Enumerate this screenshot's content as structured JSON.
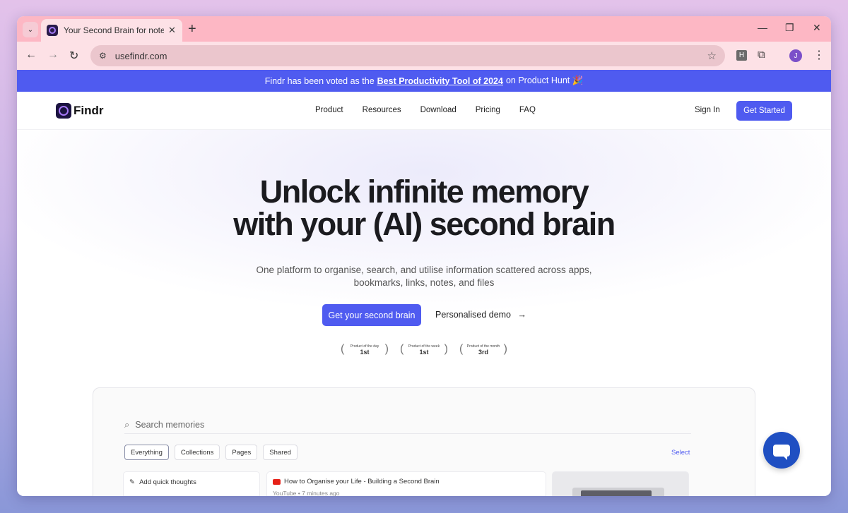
{
  "browser": {
    "tab_title": "Your Second Brain for notes, ap",
    "url": "usefindr.com",
    "avatar_initial": "J",
    "ext_label": "H"
  },
  "banner": {
    "prefix": "Findr has been voted as the",
    "link": "Best Productivity Tool of 2024",
    "suffix": "on Product Hunt 🎉"
  },
  "nav": {
    "brand": "Findr",
    "links": [
      "Product",
      "Resources",
      "Download",
      "Pricing",
      "FAQ"
    ],
    "sign_in": "Sign In",
    "get_started": "Get Started"
  },
  "hero": {
    "headline_1": "Unlock infinite memory",
    "headline_2": "with your (AI) second brain",
    "sub_1": "One platform to organise, search, and utilise information scattered across apps,",
    "sub_2": "bookmarks, links, notes, and files",
    "cta": "Get your second brain",
    "demo": "Personalised demo",
    "badges": [
      {
        "label": "Product of the day",
        "rank": "1st"
      },
      {
        "label": "Product of the week",
        "rank": "1st"
      },
      {
        "label": "Product of the month",
        "rank": "3rd"
      }
    ]
  },
  "app": {
    "search_placeholder": "Search memories",
    "filters": [
      "Everything",
      "Collections",
      "Pages",
      "Shared"
    ],
    "select": "Select",
    "quick_thoughts": "Add quick thoughts",
    "video_title": "How to Organise your Life - Building a Second Brain",
    "video_meta": "YouTube • 7 minutes ago"
  },
  "colors": {
    "accent": "#4f5bf0",
    "tabstrip": "#fdb7c4",
    "toolbar": "#fde1e6",
    "chat": "#1f4fc2"
  }
}
